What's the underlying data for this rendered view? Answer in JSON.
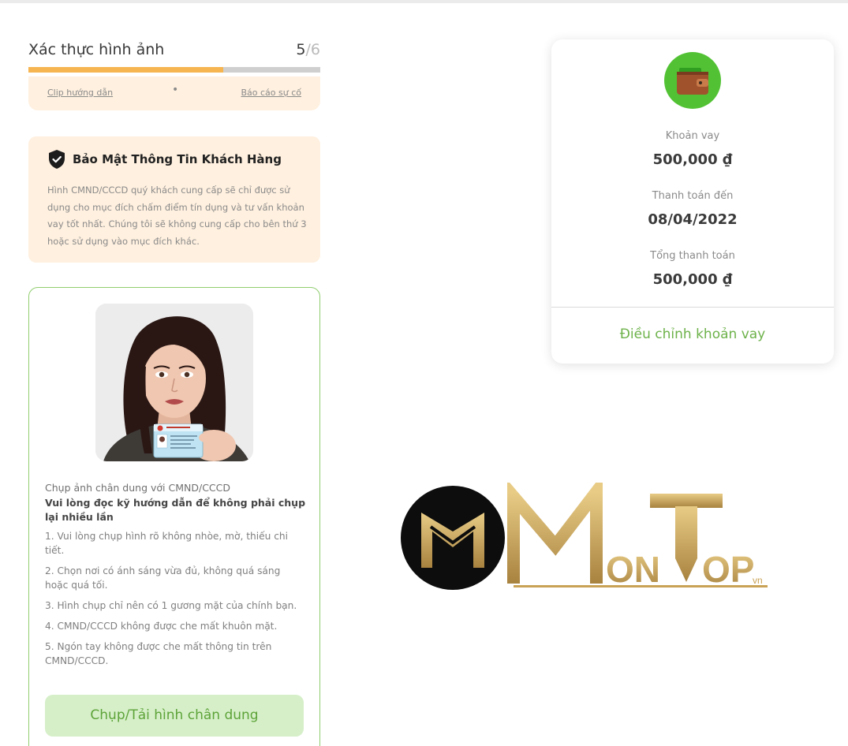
{
  "step": {
    "title": "Xác thực hình ảnh",
    "current": "5",
    "separator": "/",
    "total": "6",
    "progress_fraction": 0.6667
  },
  "help": {
    "clip_label": "Clip hướng dẫn",
    "dot": "•",
    "report_label": "Báo cáo sự cố"
  },
  "security": {
    "icon": "shield-check-icon",
    "title": "Bảo Mật Thông Tin Khách Hàng",
    "text": "Hình CMND/CCCD quý khách cung cấp sẽ chỉ được sử dụng cho mục đích chấm điểm tín dụng và tư vấn khoản vay tốt nhất. Chúng tôi sẽ không cung cấp cho bên thứ 3 hoặc sử dụng vào mục đích khác."
  },
  "capture": {
    "title": "Chụp ảnh chân dung với CMND/CCCD",
    "instruction": "Vui lòng đọc kỹ hướng dẫn để không phải chụp lại nhiều lần",
    "rules": [
      "1. Vui lòng chụp hình rõ không nhòe, mờ, thiếu chi tiết.",
      "2. Chọn nơi có ánh sáng vừa đủ, không quá sáng hoặc quá tối.",
      "3. Hình chụp chỉ nên có 1 gương mặt của chính bạn.",
      "4. CMND/CCCD không được che mất khuôn mặt.",
      "5. Ngón tay không được che mất thông tin trên CMND/CCCD."
    ],
    "button_label": "Chụp/Tải hình chân dung"
  },
  "loan": {
    "icon": "wallet-icon",
    "amount_label": "Khoản vay",
    "amount_value": "500,000 ₫",
    "due_label": "Thanh toán đến",
    "due_value": "08/04/2022",
    "total_label": "Tổng thanh toán",
    "total_value": "500,000 ₫",
    "adjust_label": "Điều chỉnh khoản vay"
  },
  "watermark": {
    "brand": "MONTOP",
    "suffix": "vn"
  },
  "colors": {
    "progress": "#f6b550",
    "soft_orange": "#fff0df",
    "green_accent": "#6db24a",
    "green_icon_bg": "#52c234",
    "button_bg": "#d6efc9",
    "gold": "#c9a256"
  }
}
